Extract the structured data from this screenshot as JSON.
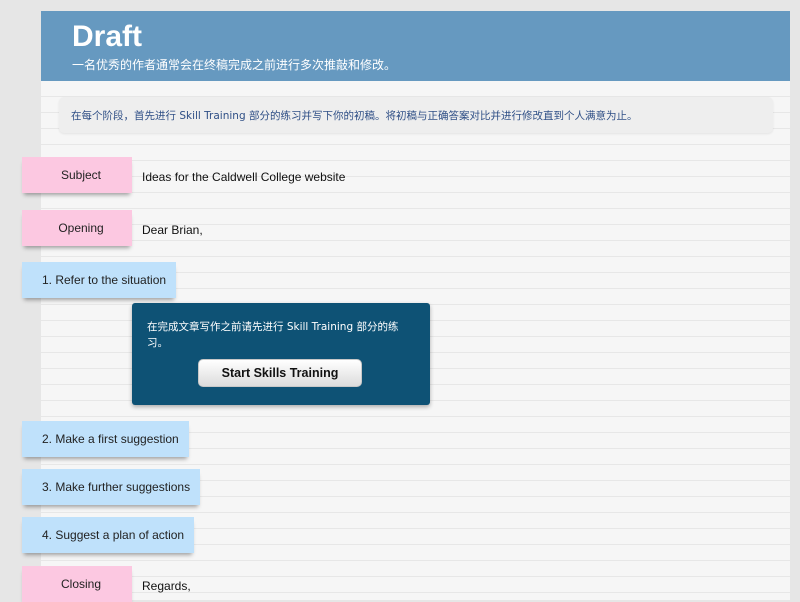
{
  "header": {
    "title": "Draft",
    "subtitle": "一名优秀的作者通常会在终稿完成之前进行多次推敲和修改。"
  },
  "instructions": "在每个阶段，首先进行 Skill Training 部分的练习并写下你的初稿。将初稿与正确答案对比并进行修改直到个人满意为止。",
  "rows": {
    "subject": {
      "label": "Subject",
      "value": "Ideas for the Caldwell College website"
    },
    "opening": {
      "label": "Opening",
      "value": "Dear Brian,"
    },
    "step1": {
      "label": "1.  Refer to the situation"
    },
    "step2": {
      "label": "2.  Make a first suggestion"
    },
    "step3": {
      "label": "3.  Make further suggestions"
    },
    "step4": {
      "label": "4.  Suggest a plan of action"
    },
    "closing": {
      "label": "Closing",
      "value": "Regards,"
    }
  },
  "popup": {
    "message": "在完成文章写作之前请先进行 Skill Training 部分的练习。",
    "button_label": "Start Skills Training"
  },
  "colors": {
    "header": "#6699c0",
    "pink_tag": "#fcc8e1",
    "blue_tag": "#bfe1fb",
    "popup": "#0e5275"
  }
}
